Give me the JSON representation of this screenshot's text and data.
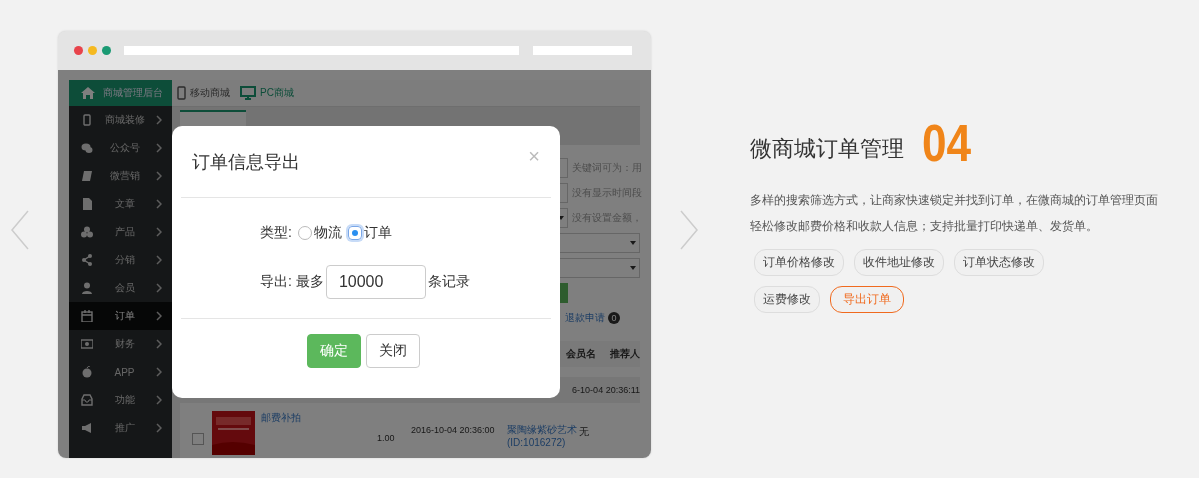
{
  "browser": {
    "dots": [
      {
        "color": "#e8434b"
      },
      {
        "color": "#f5b920"
      },
      {
        "color": "#1a9a73"
      }
    ]
  },
  "app": {
    "brand": "商城管理后台",
    "top_nav": [
      "移动商城",
      "PC商城"
    ],
    "sidebar": [
      {
        "label": "商城装修",
        "selected": false
      },
      {
        "label": "公众号",
        "selected": false
      },
      {
        "label": "微营销",
        "selected": false
      },
      {
        "label": "文章",
        "selected": false
      },
      {
        "label": "产品",
        "selected": false
      },
      {
        "label": "分销",
        "selected": false
      },
      {
        "label": "会员",
        "selected": false
      },
      {
        "label": "订单",
        "selected": true
      },
      {
        "label": "财务",
        "selected": false
      },
      {
        "label": "APP",
        "selected": false
      },
      {
        "label": "功能",
        "selected": false
      },
      {
        "label": "推广",
        "selected": false
      }
    ],
    "filters": [
      {
        "kind": "input",
        "hint": "关键词可为：用"
      },
      {
        "kind": "input",
        "hint": "没有显示时间段"
      },
      {
        "kind": "select",
        "hint": "没有设置金额，"
      },
      {
        "kind": "select"
      },
      {
        "kind": "select"
      },
      {
        "kind": "button"
      }
    ],
    "refund": {
      "label": "退款申请",
      "count": "0"
    },
    "columns": [
      "会员名",
      "推荐人"
    ],
    "group_time": "6-10-04 20:36:11",
    "rows": [
      {
        "checked": false,
        "product": "邮费补拍",
        "price": "1.00",
        "time": "2016-10-04 20:36:00",
        "member": "聚陶缘紫砂艺术",
        "member_id": "(ID:1016272)",
        "referrer": "无"
      }
    ]
  },
  "modal": {
    "title": "订单信息导出",
    "close": "×",
    "type_label": "类型:",
    "options": [
      {
        "label": "物流",
        "selected": false
      },
      {
        "label": "订单",
        "selected": true
      }
    ],
    "export_label": "导出:",
    "prefix": "最多",
    "value": "10000",
    "suffix": "条记录",
    "buttons": [
      {
        "label": "确定",
        "kind": "primary"
      },
      {
        "label": "关闭",
        "kind": "default"
      }
    ]
  },
  "feature": {
    "title": "微商城订单管理",
    "number": "04",
    "description": "多样的搜索筛选方式，让商家快速锁定并找到订单，在微商城的订单管理页面轻松修改邮费价格和收款人信息；支持批量打印快递单、发货单。",
    "tags": [
      {
        "label": "订单价格修改",
        "selected": false
      },
      {
        "label": "收件地址修改",
        "selected": false
      },
      {
        "label": "订单状态修改",
        "selected": false
      },
      {
        "label": "运费修改",
        "selected": false
      },
      {
        "label": "导出订单",
        "selected": true
      }
    ]
  }
}
